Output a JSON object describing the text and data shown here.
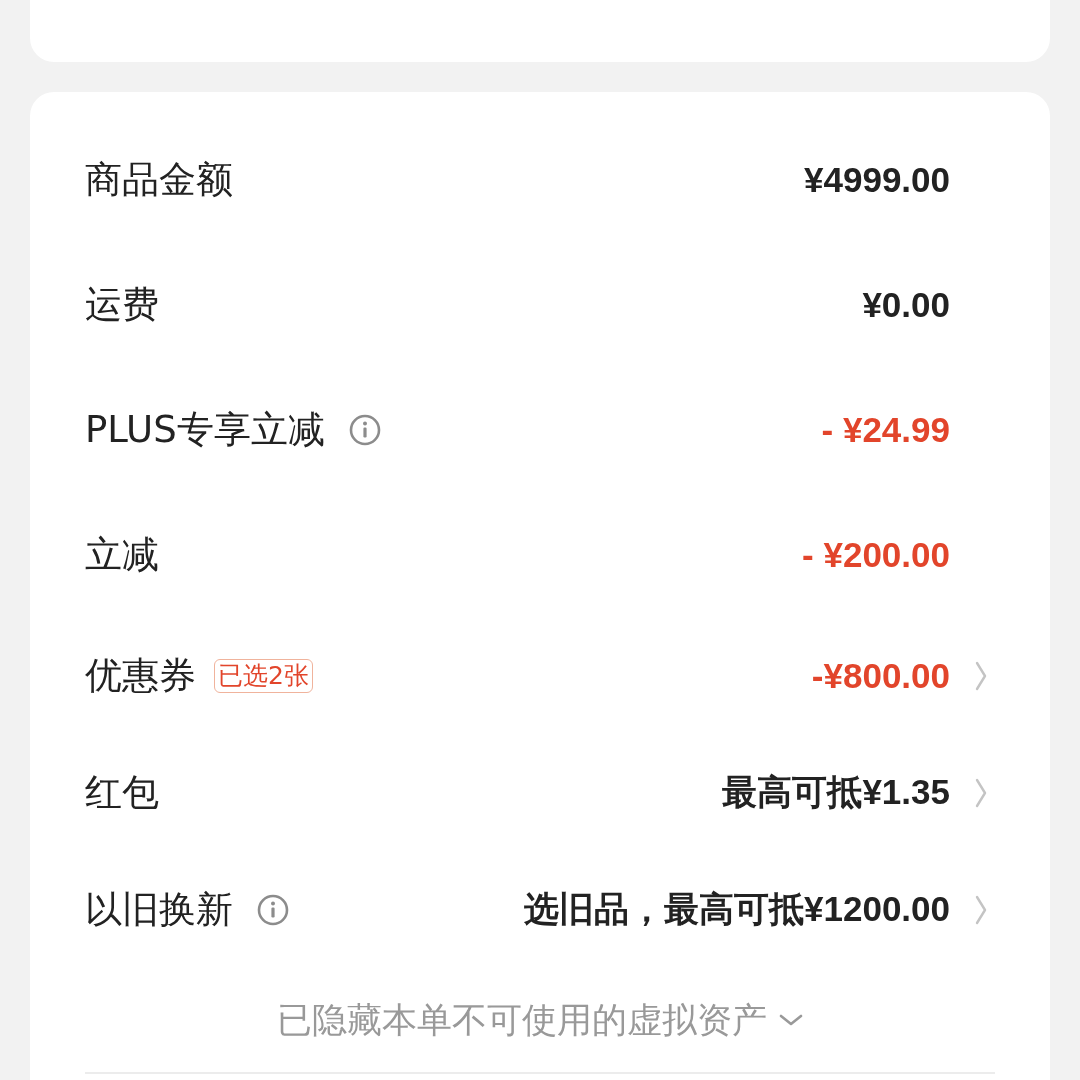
{
  "price_rows": [
    {
      "label": "商品金额",
      "info": false,
      "value": "¥4999.00",
      "kind": "plain",
      "chevron": false
    },
    {
      "label": "运费",
      "info": false,
      "value": "¥0.00",
      "kind": "plain",
      "chevron": false
    },
    {
      "label": "PLUS专享立减",
      "info": true,
      "value": "- ¥24.99",
      "kind": "discount",
      "chevron": false
    },
    {
      "label": "立减",
      "info": false,
      "value": "- ¥200.00",
      "kind": "discount",
      "chevron": false
    },
    {
      "label": "优惠券",
      "info": false,
      "badge": "已选2张",
      "value": "-¥800.00",
      "kind": "discount",
      "chevron": true
    },
    {
      "label": "红包",
      "info": false,
      "value": "最高可抵¥1.35",
      "kind": "plain",
      "chevron": true
    },
    {
      "label": "以旧换新",
      "info": true,
      "value": "选旧品，最高可抵¥1200.00",
      "kind": "plain",
      "chevron": true
    }
  ],
  "hidden_assets": {
    "text": "已隐藏本单不可使用的虚拟资产",
    "expanded": false
  }
}
